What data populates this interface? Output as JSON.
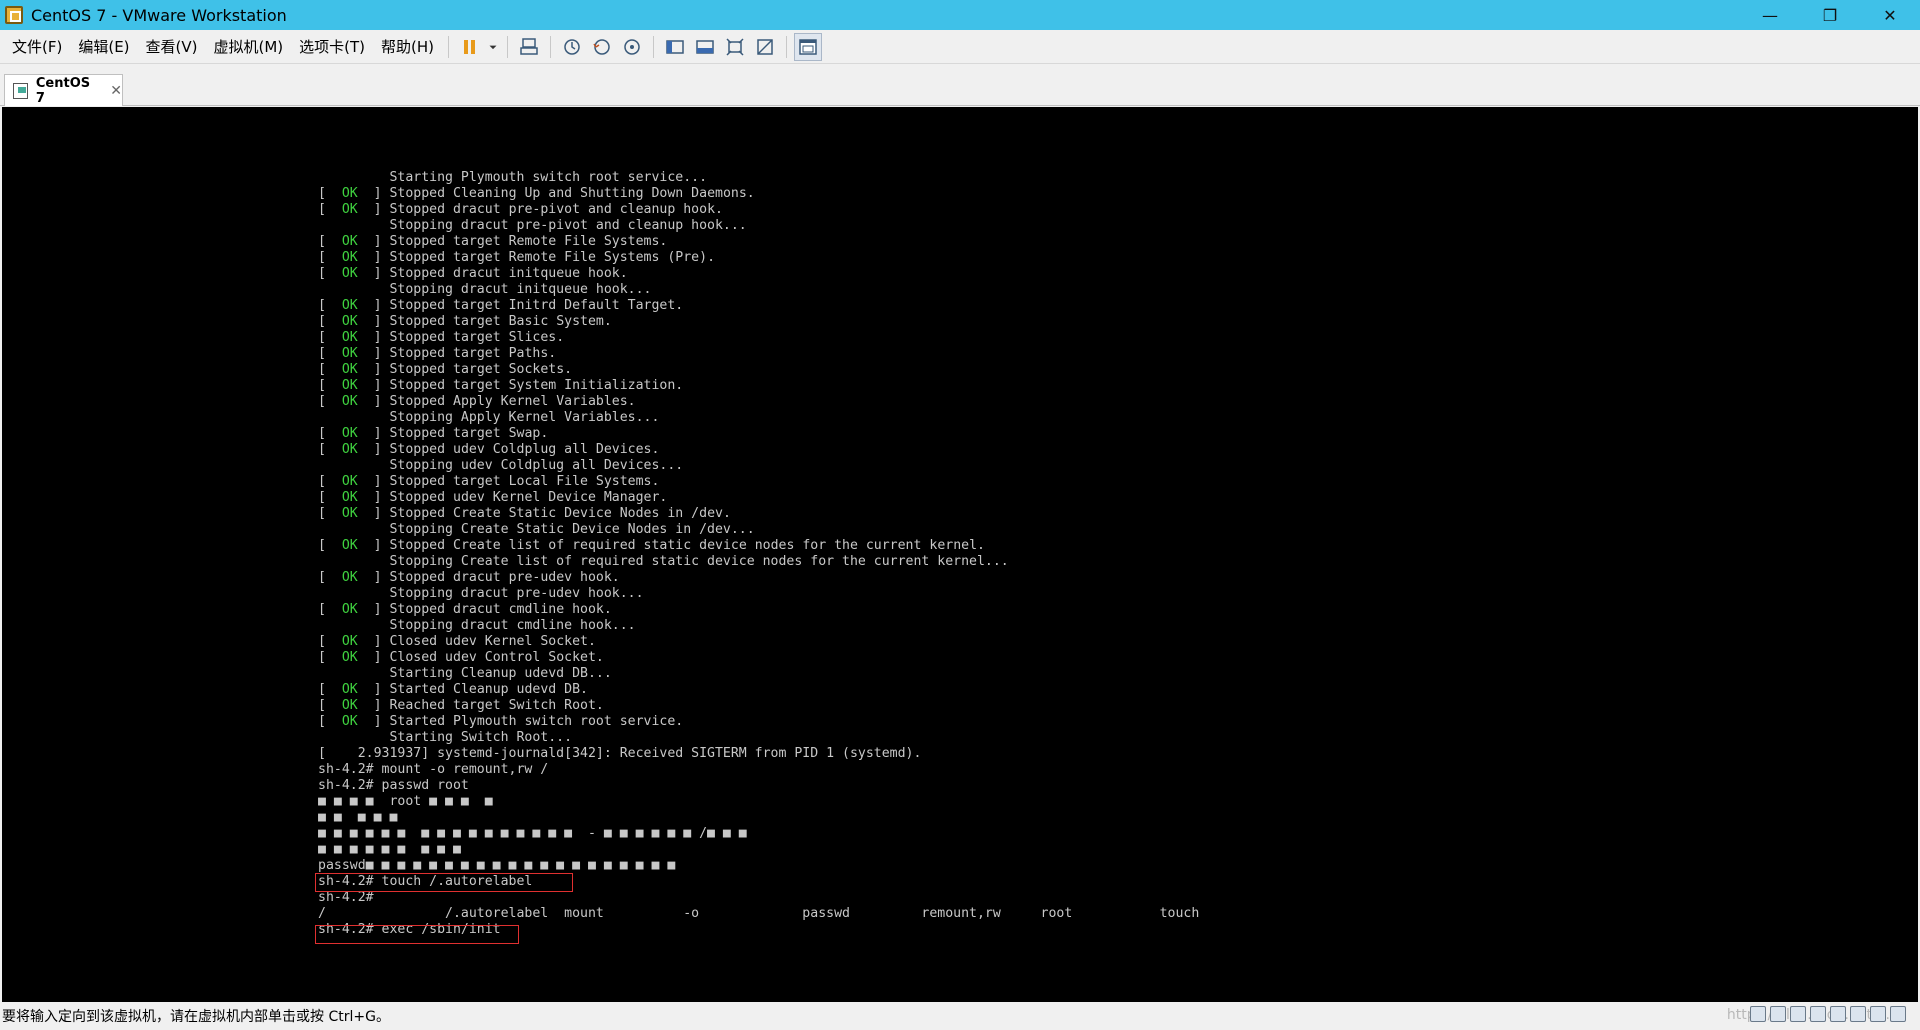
{
  "window": {
    "title": "CentOS 7 - VMware Workstation",
    "minimize": "—",
    "restore": "❐",
    "close": "✕"
  },
  "menu": [
    {
      "label": "文件(F)"
    },
    {
      "label": "编辑(E)"
    },
    {
      "label": "查看(V)"
    },
    {
      "label": "虚拟机(M)"
    },
    {
      "label": "选项卡(T)"
    },
    {
      "label": "帮助(H)"
    }
  ],
  "tab": {
    "label": "CentOS 7",
    "close": "✕"
  },
  "console": {
    "lines": [
      {
        "prefix": "",
        "ok": false,
        "text": "         Starting Plymouth switch root service..."
      },
      {
        "ok": true,
        "text": "Stopped Cleaning Up and Shutting Down Daemons."
      },
      {
        "ok": true,
        "text": "Stopped dracut pre-pivot and cleanup hook."
      },
      {
        "ok": false,
        "text": "         Stopping dracut pre-pivot and cleanup hook..."
      },
      {
        "ok": true,
        "text": "Stopped target Remote File Systems."
      },
      {
        "ok": true,
        "text": "Stopped target Remote File Systems (Pre)."
      },
      {
        "ok": true,
        "text": "Stopped dracut initqueue hook."
      },
      {
        "ok": false,
        "text": "         Stopping dracut initqueue hook..."
      },
      {
        "ok": true,
        "text": "Stopped target Initrd Default Target."
      },
      {
        "ok": true,
        "text": "Stopped target Basic System."
      },
      {
        "ok": true,
        "text": "Stopped target Slices."
      },
      {
        "ok": true,
        "text": "Stopped target Paths."
      },
      {
        "ok": true,
        "text": "Stopped target Sockets."
      },
      {
        "ok": true,
        "text": "Stopped target System Initialization."
      },
      {
        "ok": true,
        "text": "Stopped Apply Kernel Variables."
      },
      {
        "ok": false,
        "text": "         Stopping Apply Kernel Variables..."
      },
      {
        "ok": true,
        "text": "Stopped target Swap."
      },
      {
        "ok": true,
        "text": "Stopped udev Coldplug all Devices."
      },
      {
        "ok": false,
        "text": "         Stopping udev Coldplug all Devices..."
      },
      {
        "ok": true,
        "text": "Stopped target Local File Systems."
      },
      {
        "ok": true,
        "text": "Stopped udev Kernel Device Manager."
      },
      {
        "ok": true,
        "text": "Stopped Create Static Device Nodes in /dev."
      },
      {
        "ok": false,
        "text": "         Stopping Create Static Device Nodes in /dev..."
      },
      {
        "ok": true,
        "text": "Stopped Create list of required static device nodes for the current kernel."
      },
      {
        "ok": false,
        "text": "         Stopping Create list of required static device nodes for the current kernel..."
      },
      {
        "ok": true,
        "text": "Stopped dracut pre-udev hook."
      },
      {
        "ok": false,
        "text": "         Stopping dracut pre-udev hook..."
      },
      {
        "ok": true,
        "text": "Stopped dracut cmdline hook."
      },
      {
        "ok": false,
        "text": "         Stopping dracut cmdline hook..."
      },
      {
        "ok": true,
        "text": "Closed udev Kernel Socket."
      },
      {
        "ok": true,
        "text": "Closed udev Control Socket."
      },
      {
        "ok": false,
        "text": "         Starting Cleanup udevd DB..."
      },
      {
        "ok": true,
        "text": "Started Cleanup udevd DB."
      },
      {
        "ok": true,
        "text": "Reached target Switch Root."
      },
      {
        "ok": true,
        "text": "Started Plymouth switch root service."
      },
      {
        "ok": false,
        "text": "         Starting Switch Root..."
      },
      {
        "ok": false,
        "text": "[    2.931937] systemd-journald[342]: Received SIGTERM from PID 1 (systemd)."
      },
      {
        "ok": false,
        "text": "sh-4.2# mount -o remount,rw /"
      },
      {
        "ok": false,
        "text": "sh-4.2# passwd root"
      },
      {
        "ok": false,
        "text": "■ ■ ■ ■  root ■ ■ ■  ■"
      },
      {
        "ok": false,
        "text": "■ ■  ■ ■ ■"
      },
      {
        "ok": false,
        "text": "■ ■ ■ ■ ■ ■  ■ ■ ■ ■ ■ ■ ■ ■ ■ ■  - ■ ■ ■ ■ ■ ■ /■ ■ ■"
      },
      {
        "ok": false,
        "text": "■ ■ ■ ■ ■ ■  ■ ■ ■"
      },
      {
        "ok": false,
        "text": "passwd■ ■ ■ ■ ■ ■ ■ ■ ■ ■ ■ ■ ■ ■ ■ ■ ■ ■ ■ ■"
      },
      {
        "ok": false,
        "text": "sh-4.2# touch /.autorelabel"
      },
      {
        "ok": false,
        "text": "sh-4.2#"
      },
      {
        "ok": false,
        "text": "/               /.autorelabel  mount          -o             passwd         remount,rw     root           touch"
      },
      {
        "ok": false,
        "text": "sh-4.2# exec /sbin/init"
      }
    ]
  },
  "status": {
    "text": "要将输入定向到该虚拟机，请在虚拟机内部单击或按 Ctrl+G。",
    "watermark": "https://blog.csdn.net/..."
  }
}
